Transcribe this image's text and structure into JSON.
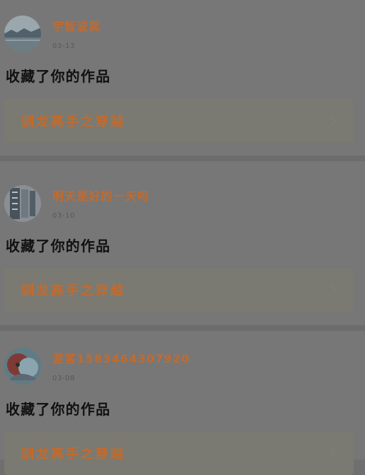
{
  "feed": {
    "items": [
      {
        "username": "宇智波冥",
        "date": "03-13",
        "action": "收藏了你的作品",
        "work_title": "驯龙高手之穿越",
        "avatar": "landscape-avatar"
      },
      {
        "username": "明天是好的一天吗",
        "date": "03-10",
        "action": "收藏了你的作品",
        "work_title": "驯龙高手之穿越",
        "avatar": "calligraphy-avatar"
      },
      {
        "username": "游客1583464307920",
        "date": "03-08",
        "action": "收藏了你的作品",
        "work_title": "驯龙高手之穿越",
        "avatar": "anime-avatar"
      }
    ]
  },
  "colors": {
    "overlay_background": "#777777",
    "username": "#c46a2b",
    "date": "#585858",
    "action_text": "#111111",
    "work_link_background": "#7a7a72"
  },
  "icons": {
    "chevron": "chevron-right-icon"
  }
}
